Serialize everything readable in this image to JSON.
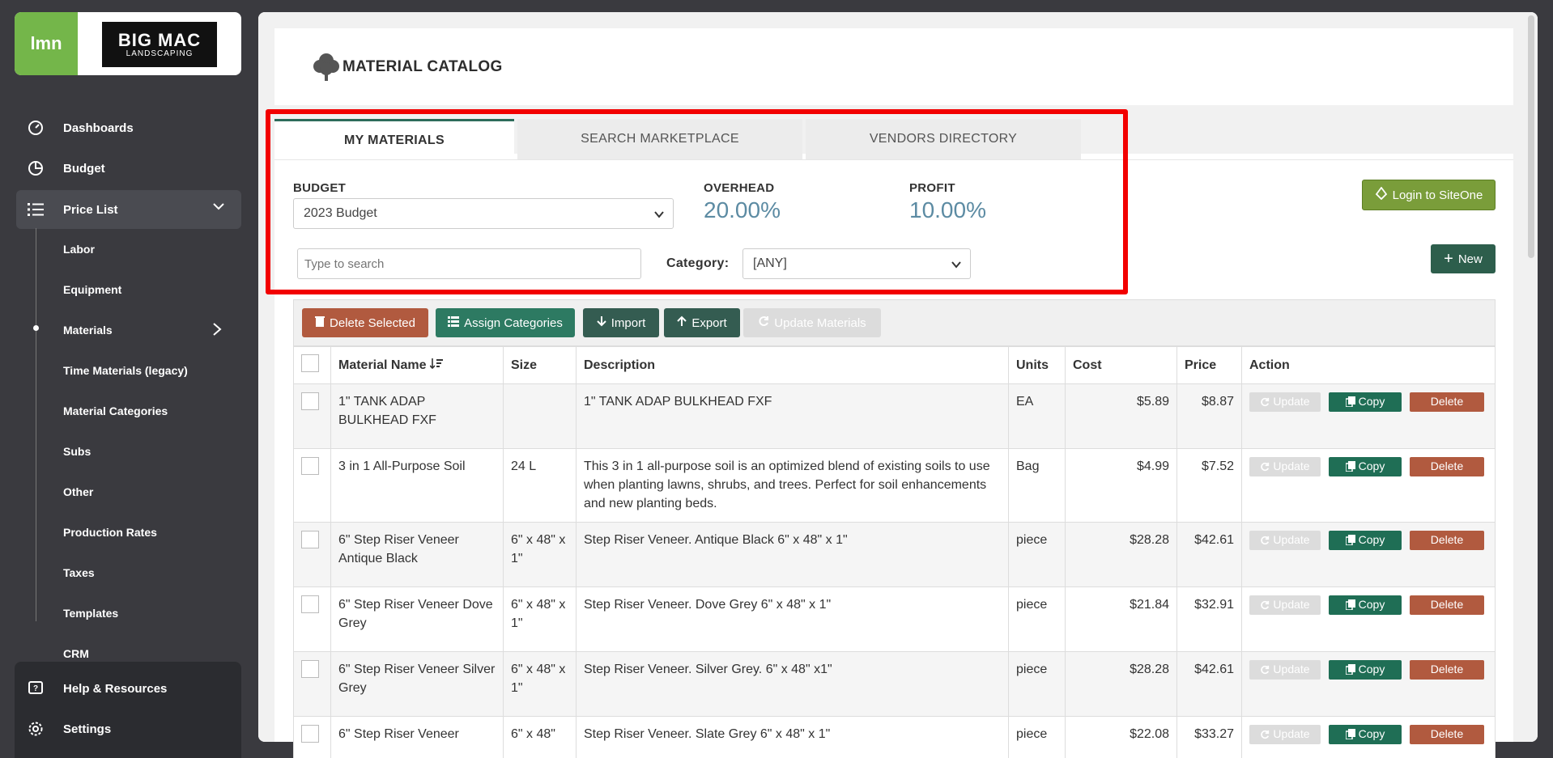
{
  "brand": {
    "lmn": "lmn",
    "company_line1": "BIG MAC",
    "company_line2": "LANDSCAPING"
  },
  "sidebar": {
    "items": [
      {
        "label": "Dashboards",
        "icon": "dashboard-icon"
      },
      {
        "label": "Budget",
        "icon": "pie-chart-icon"
      },
      {
        "label": "Price List",
        "icon": "list-icon"
      }
    ],
    "sub_items": [
      "Labor",
      "Equipment",
      "Materials",
      "Time Materials (legacy)",
      "Material Categories",
      "Subs",
      "Other",
      "Production Rates",
      "Taxes",
      "Templates",
      "CRM"
    ],
    "bottom": [
      {
        "label": "Help & Resources",
        "icon": "help-icon"
      },
      {
        "label": "Settings",
        "icon": "gear-icon"
      }
    ]
  },
  "page": {
    "title": "MATERIAL CATALOG"
  },
  "tabs": [
    "MY MATERIALS",
    "SEARCH MARKETPLACE",
    "VENDORS DIRECTORY"
  ],
  "budget": {
    "label": "BUDGET",
    "value": "2023 Budget"
  },
  "overhead": {
    "label": "OVERHEAD",
    "value": "20.00%"
  },
  "profit": {
    "label": "PROFIT",
    "value": "10.00%"
  },
  "search": {
    "placeholder": "Type to search"
  },
  "category": {
    "label": "Category:",
    "value": "[ANY]"
  },
  "buttons": {
    "login_siteone": "Login to SiteOne",
    "new": "New",
    "delete_selected": "Delete Selected",
    "assign_categories": "Assign Categories",
    "import": "Import",
    "export": "Export",
    "update_materials": "Update Materials"
  },
  "table": {
    "headers": [
      "Material Name",
      "Size",
      "Description",
      "Units",
      "Cost",
      "Price",
      "Action"
    ],
    "action_labels": {
      "update": "Update",
      "copy": "Copy",
      "delete": "Delete"
    },
    "rows": [
      {
        "name": "1\" TANK ADAP BULKHEAD FXF",
        "size": "",
        "description": "1\" TANK ADAP BULKHEAD FXF",
        "units": "EA",
        "cost": "$5.89",
        "price": "$8.87"
      },
      {
        "name": "3 in 1 All-Purpose Soil",
        "size": "24 L",
        "description": "This 3 in 1 all-purpose soil is an optimized blend of existing soils to use when planting lawns, shrubs, and trees. Perfect for soil enhancements and new planting beds.",
        "units": "Bag",
        "cost": "$4.99",
        "price": "$7.52"
      },
      {
        "name": "6\" Step Riser Veneer Antique Black",
        "size": "6\" x 48\" x 1\"",
        "description": "Step Riser Veneer. Antique Black 6\" x 48\" x 1\"",
        "units": "piece",
        "cost": "$28.28",
        "price": "$42.61"
      },
      {
        "name": "6\" Step Riser Veneer Dove Grey",
        "size": "6\" x 48\" x 1\"",
        "description": "Step Riser Veneer. Dove Grey 6\" x 48\" x 1\"",
        "units": "piece",
        "cost": "$21.84",
        "price": "$32.91"
      },
      {
        "name": "6\" Step Riser Veneer Silver Grey",
        "size": "6\" x 48\" x 1\"",
        "description": "Step Riser Veneer. Silver Grey. 6\" x 48\" x1\"",
        "units": "piece",
        "cost": "$28.28",
        "price": "$42.61"
      },
      {
        "name": "6\" Step Riser Veneer",
        "size": "6\" x 48\"",
        "description": "Step Riser Veneer. Slate Grey 6\" x 48\" x 1\"",
        "units": "piece",
        "cost": "$22.08",
        "price": "$33.27"
      }
    ]
  }
}
